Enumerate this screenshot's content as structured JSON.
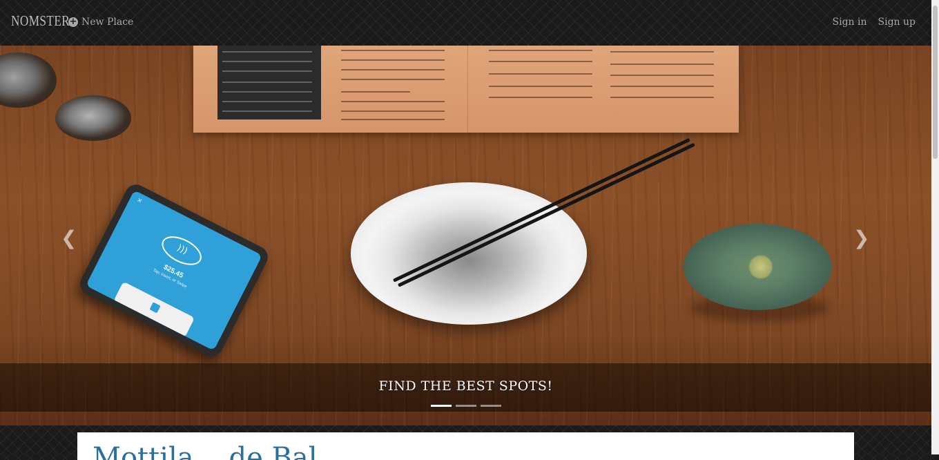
{
  "navbar": {
    "brand": "NOMSTER",
    "new_place_label": "New Place",
    "new_place_icon": "plus-circle-icon",
    "sign_in_label": "Sign in",
    "sign_up_label": "Sign up"
  },
  "hero": {
    "caption": "FIND THE BEST SPOTS!",
    "prev_icon": "chevron-left-icon",
    "next_icon": "chevron-right-icon",
    "indicator_count": 3,
    "active_indicator": 1,
    "terminal_amount": "$25.45",
    "terminal_prompt": "Tap, insert, or Swipe"
  },
  "content": {
    "title": "Mottila... de Bal"
  },
  "colors": {
    "navbar_bg": "#1a1a1a",
    "nav_text": "#a9a9a9",
    "title_blue": "#2a6f9e"
  }
}
